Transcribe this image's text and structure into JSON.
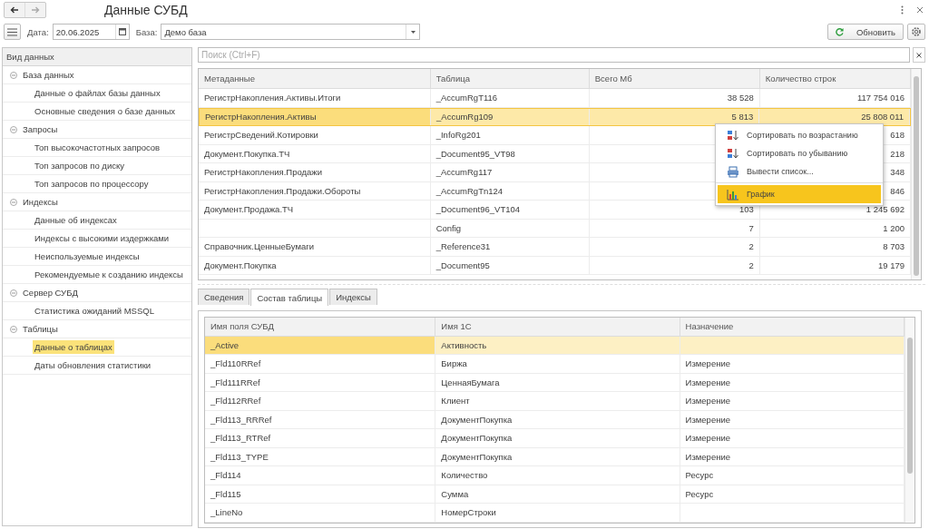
{
  "window": {
    "title": "Данные СУБД"
  },
  "toolbar": {
    "date_label": "Дата:",
    "date": "20.06.2025",
    "base_label": "База:",
    "base": "Демо база",
    "refresh_button": "Обновить"
  },
  "sidebar": {
    "header": "Вид данных",
    "groups": [
      {
        "label": "База данных",
        "expanded": true,
        "children": [
          {
            "label": "Данные о файлах базы данных",
            "selected": false
          },
          {
            "label": "Основные сведения о базе данных",
            "selected": false
          }
        ]
      },
      {
        "label": "Запросы",
        "expanded": true,
        "children": [
          {
            "label": "Топ высокочастотных запросов",
            "selected": false
          },
          {
            "label": "Топ запросов по диску",
            "selected": false
          },
          {
            "label": "Топ запросов по процессору",
            "selected": false
          }
        ]
      },
      {
        "label": "Индексы",
        "expanded": true,
        "children": [
          {
            "label": "Данные об индексах",
            "selected": false
          },
          {
            "label": "Индексы с высокими издержками",
            "selected": false
          },
          {
            "label": "Неиспользуемые индексы",
            "selected": false
          },
          {
            "label": "Рекомендуемые к созданию индексы",
            "selected": false
          }
        ]
      },
      {
        "label": "Сервер СУБД",
        "expanded": true,
        "children": [
          {
            "label": "Статистика ожиданий MSSQL",
            "selected": false
          }
        ]
      },
      {
        "label": "Таблицы",
        "expanded": true,
        "children": [
          {
            "label": "Данные о таблицах",
            "selected": true
          },
          {
            "label": "Даты обновления статистики",
            "selected": false
          }
        ]
      }
    ]
  },
  "search": {
    "placeholder": "Поиск (Ctrl+F)"
  },
  "tables_grid": {
    "columns": [
      "Метаданные",
      "Таблица",
      "Всего Мб",
      "Количество строк"
    ],
    "rows": [
      {
        "cells": [
          "РегистрНакопления.Активы.Итоги",
          "_AccumRgT116",
          "38 528",
          "117 754 016"
        ],
        "selected": false
      },
      {
        "cells": [
          "РегистрНакопления.Активы",
          "_AccumRg109",
          "5 813",
          "25 808 011"
        ],
        "selected": true
      },
      {
        "cells": [
          "РегистрСведений.Котировки",
          "_InfoRg201",
          "",
          "618"
        ],
        "selected": false
      },
      {
        "cells": [
          "Документ.Покупка.ТЧ",
          "_Document95_VT98",
          "",
          "218"
        ],
        "selected": false
      },
      {
        "cells": [
          "РегистрНакопления.Продажи",
          "_AccumRg117",
          "",
          "348"
        ],
        "selected": false
      },
      {
        "cells": [
          "РегистрНакопления.Продажи.Обороты",
          "_AccumRgTn124",
          "",
          "846"
        ],
        "selected": false
      },
      {
        "cells": [
          "Документ.Продажа.ТЧ",
          "_Document96_VT104",
          "103",
          "1 245 692"
        ],
        "selected": false
      },
      {
        "cells": [
          "",
          "Config",
          "7",
          "1 200"
        ],
        "selected": false
      },
      {
        "cells": [
          "Справочник.ЦенныеБумаги",
          "_Reference31",
          "2",
          "8 703"
        ],
        "selected": false
      },
      {
        "cells": [
          "Документ.Покупка",
          "_Document95",
          "2",
          "19 179"
        ],
        "selected": false
      }
    ]
  },
  "context_menu": {
    "items": [
      {
        "kind": "sort-asc",
        "label": "Сортировать по возрастанию",
        "selected": false
      },
      {
        "kind": "sort-desc",
        "label": "Сортировать по убыванию",
        "selected": false
      },
      {
        "kind": "print",
        "label": "Вывести список...",
        "selected": false
      },
      {
        "kind": "separator"
      },
      {
        "kind": "chart",
        "label": "График",
        "selected": true
      }
    ]
  },
  "tabs": [
    {
      "label": "Сведения",
      "selected": false
    },
    {
      "label": "Состав таблицы",
      "selected": true
    },
    {
      "label": "Индексы",
      "selected": false
    }
  ],
  "fields_grid": {
    "columns": [
      "Имя поля СУБД",
      "Имя 1С",
      "Назначение"
    ],
    "rows": [
      {
        "cells": [
          "_Active",
          "Активность",
          ""
        ],
        "selected": true
      },
      {
        "cells": [
          "_Fld110RRef",
          "Биржа",
          "Измерение"
        ],
        "selected": false
      },
      {
        "cells": [
          "_Fld111RRef",
          "ЦеннаяБумага",
          "Измерение"
        ],
        "selected": false
      },
      {
        "cells": [
          "_Fld112RRef",
          "Клиент",
          "Измерение"
        ],
        "selected": false
      },
      {
        "cells": [
          "_Fld113_RRRef",
          "ДокументПокупка",
          "Измерение"
        ],
        "selected": false
      },
      {
        "cells": [
          "_Fld113_RTRef",
          "ДокументПокупка",
          "Измерение"
        ],
        "selected": false
      },
      {
        "cells": [
          "_Fld113_TYPE",
          "ДокументПокупка",
          "Измерение"
        ],
        "selected": false
      },
      {
        "cells": [
          "_Fld114",
          "Количество",
          "Ресурс"
        ],
        "selected": false
      },
      {
        "cells": [
          "_Fld115",
          "Сумма",
          "Ресурс"
        ],
        "selected": false
      },
      {
        "cells": [
          "_LineNo",
          "НомерСтроки",
          ""
        ],
        "selected": false
      }
    ]
  }
}
